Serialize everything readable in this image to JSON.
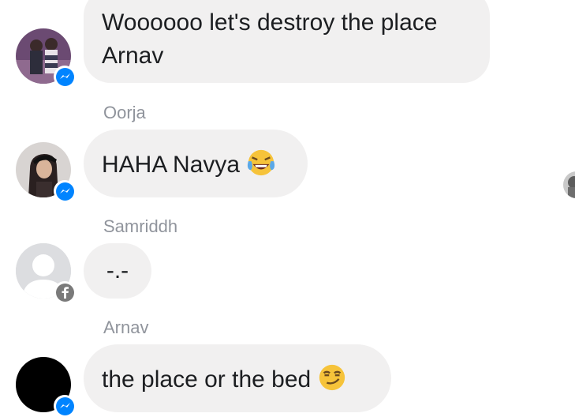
{
  "messages": [
    {
      "sender": "",
      "text_line1": "Woooooo let's destroy the place",
      "text_line2": "Arnav",
      "badge": "messenger-icon",
      "emoji": ""
    },
    {
      "sender": "Oorja",
      "text": "HAHA Navya",
      "badge": "messenger-icon",
      "emoji": "face-with-tears-of-joy-emoji"
    },
    {
      "sender": "Samriddh",
      "text": "-.-",
      "badge": "facebook-icon",
      "emoji": ""
    },
    {
      "sender": "Arnav",
      "text": "the place or the bed",
      "badge": "messenger-icon",
      "emoji": "smirking-face-emoji"
    }
  ],
  "colors": {
    "bubble_bg": "#f1f0f0",
    "sender_text": "#90949c",
    "messenger_blue": "#0084ff",
    "facebook_badge_gray": "#7a7a7a"
  }
}
